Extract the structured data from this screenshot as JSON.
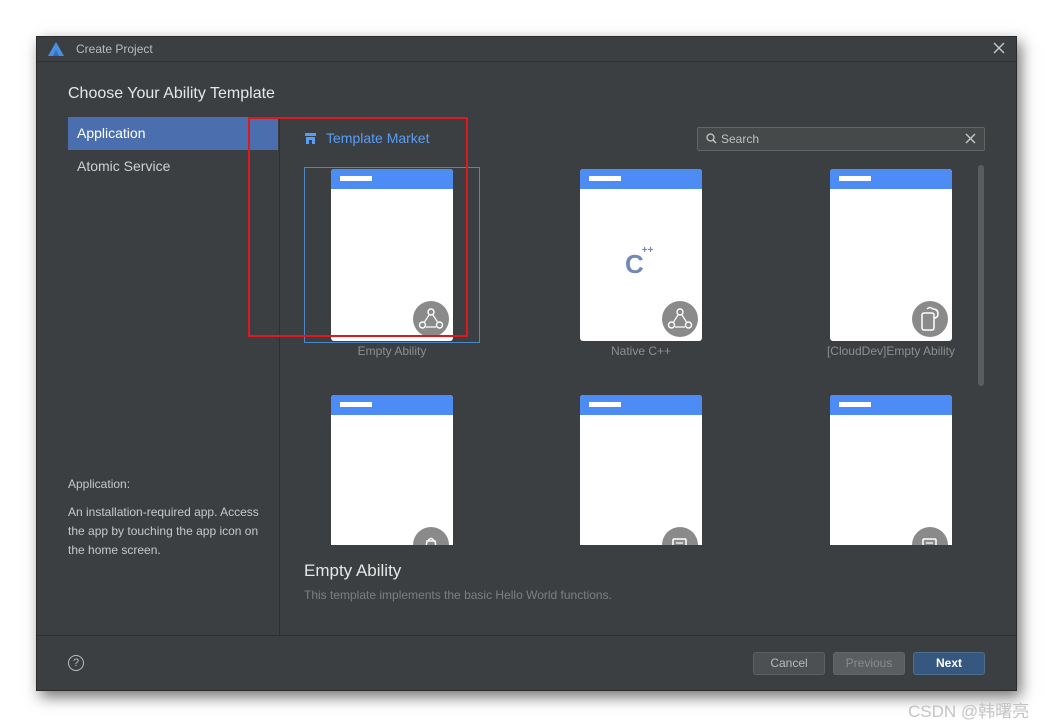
{
  "window": {
    "title": "Create Project",
    "heading": "Choose Your Ability Template"
  },
  "sidebar": {
    "items": [
      {
        "label": "Application",
        "active": true
      },
      {
        "label": "Atomic Service",
        "active": false
      }
    ],
    "description_title": "Application:",
    "description": "An installation-required app. Access the app by touching the app icon on the home screen."
  },
  "market": {
    "label": "Template Market"
  },
  "search": {
    "placeholder": "Search",
    "value": ""
  },
  "templates": [
    {
      "label": "Empty Ability",
      "icon": "triangle-nodes-icon",
      "selected": true
    },
    {
      "label": "Native C++",
      "icon": "triangle-nodes-icon",
      "selected": false
    },
    {
      "label": "[CloudDev]Empty Ability",
      "icon": "cloud-device-icon",
      "selected": false
    },
    {
      "label": "",
      "icon": "bag-icon",
      "selected": false
    },
    {
      "label": "",
      "icon": "screen-icon",
      "selected": false
    },
    {
      "label": "",
      "icon": "screen-icon",
      "selected": false
    }
  ],
  "cpp_glyph": "C",
  "cpp_suffix": "++",
  "selected_template": {
    "title": "Empty Ability",
    "description": "This template implements the basic Hello World functions."
  },
  "footer": {
    "help_glyph": "?",
    "cancel": "Cancel",
    "previous": "Previous",
    "next": "Next"
  },
  "watermark": "CSDN @韩曙亮",
  "colors": {
    "accent": "#4b6eaf",
    "link": "#589df6",
    "card_header": "#4e8cf5",
    "highlight_box": "#e0181e"
  }
}
